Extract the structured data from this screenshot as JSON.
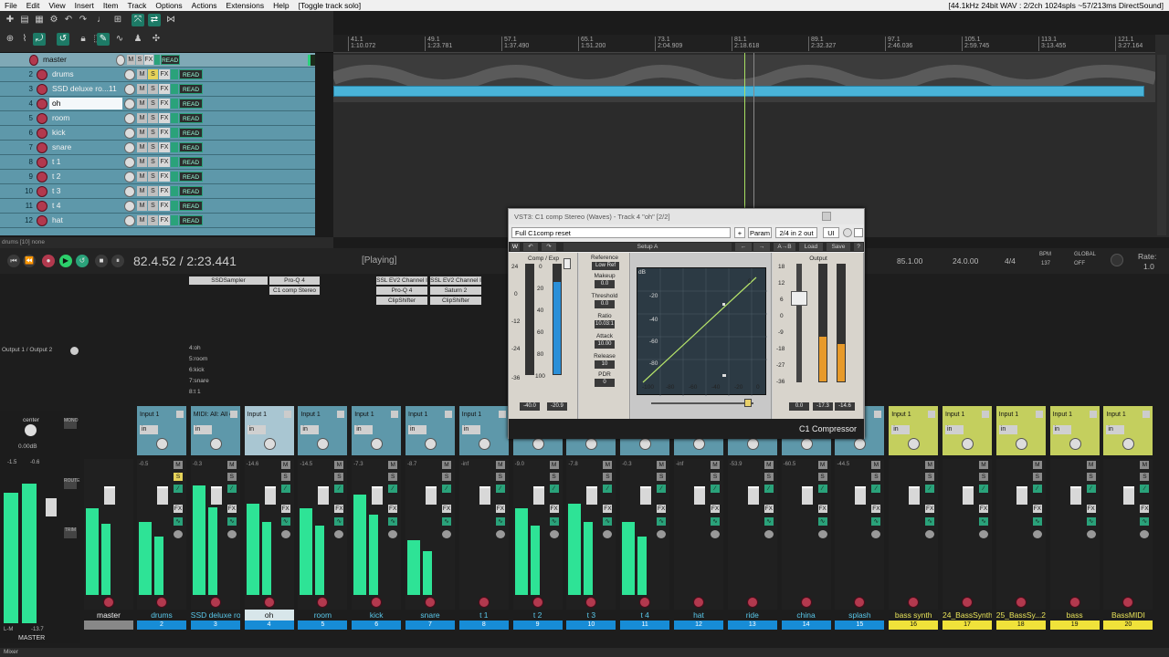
{
  "menu": {
    "items": [
      "File",
      "Edit",
      "View",
      "Insert",
      "Item",
      "Track",
      "Options",
      "Actions",
      "Extensions",
      "Help"
    ],
    "action_hint": "[Toggle track solo]",
    "audio_status": "[44.1kHz 24bit WAV : 2/2ch 1024spls ~57/213ms DirectSound]"
  },
  "tracks": [
    {
      "num": "",
      "name": "master"
    },
    {
      "num": "2",
      "name": "drums"
    },
    {
      "num": "3",
      "name": "SSD deluxe ro...11"
    },
    {
      "num": "4",
      "name": "oh"
    },
    {
      "num": "5",
      "name": "room"
    },
    {
      "num": "6",
      "name": "kick"
    },
    {
      "num": "7",
      "name": "snare"
    },
    {
      "num": "8",
      "name": "t 1"
    },
    {
      "num": "9",
      "name": "t 2"
    },
    {
      "num": "10",
      "name": "t 3"
    },
    {
      "num": "11",
      "name": "t 4"
    },
    {
      "num": "12",
      "name": "hat"
    }
  ],
  "tcp_buttons": {
    "m": "M",
    "s": "S",
    "fx": "FX",
    "read": "READ"
  },
  "ruler": [
    "41.1",
    "49.1",
    "57.1",
    "65.1",
    "73.1",
    "81.1",
    "89.1",
    "97.1",
    "105.1",
    "113.1",
    "121.1"
  ],
  "ruler_times": [
    "1:10.072",
    "1:23.781",
    "1:37.490",
    "1:51.200",
    "2:04.909",
    "2:18.618",
    "2:32.327",
    "2:46.036",
    "2:59.745",
    "3:13.455",
    "3:27.164"
  ],
  "status_line": "drums [10] none",
  "transport": {
    "position": "82.4.52 / 2:23.441",
    "state": "[Playing]",
    "sel_start": "85.1.00",
    "sel_end": "24.0.00",
    "timesig": "4/4",
    "bpm_label": "BPM",
    "bpm": "137",
    "global": "GLOBAL",
    "global_state": "OFF",
    "rate_label": "Rate:",
    "rate": "1.0"
  },
  "mixer": {
    "master_label": "MASTER",
    "master_name": "master",
    "master_db": "0.00dB",
    "master_pan": "center",
    "output_label": "Output 1 / Output 2",
    "master_peak_l": "-1.5",
    "master_peak_r": "-0.6",
    "master_lm": "L-M",
    "master_lm_val": "-13.7",
    "side_buttons": [
      "MONO",
      "ROUTE",
      "TRIM"
    ],
    "routing": [
      "4:oh",
      "5:room",
      "6:kick",
      "7:snare",
      "8:t 1"
    ],
    "fx": {
      "ssd": "SSDSampler",
      "proq": "Pro-Q 4",
      "c1": "C1 comp Stereo",
      "ssl1": "SSL EV2 Channel I",
      "ssl2": "SSL EV2 Channel I",
      "proq2": "Pro-Q 4",
      "sat": "Saturn 2",
      "clip1": "ClipShifter",
      "clip2": "ClipShifter"
    },
    "strips": [
      {
        "name": "drums",
        "num": "2",
        "input": "Input 1",
        "db": "-0.5"
      },
      {
        "name": "SSD deluxe rock ...11",
        "num": "3",
        "input": "MIDI: All: All channel",
        "db": "-0.3"
      },
      {
        "name": "oh",
        "num": "4",
        "input": "Input 1",
        "db": "-14.6"
      },
      {
        "name": "room",
        "num": "5",
        "input": "Input 1",
        "db": "-14.5"
      },
      {
        "name": "kick",
        "num": "6",
        "input": "Input 1",
        "db": "-7.3"
      },
      {
        "name": "snare",
        "num": "7",
        "input": "Input 1",
        "db": "-8.7"
      },
      {
        "name": "t 1",
        "num": "8",
        "input": "Input 1",
        "db": "-inf"
      },
      {
        "name": "t 2",
        "num": "9",
        "input": "Input 1",
        "db": "-9.0"
      },
      {
        "name": "t 3",
        "num": "10",
        "input": "Input 1",
        "db": "-7.8"
      },
      {
        "name": "t 4",
        "num": "11",
        "input": "Input 1",
        "db": "-0.3"
      },
      {
        "name": "hat",
        "num": "12",
        "input": "Input 1",
        "db": "-inf"
      },
      {
        "name": "ride",
        "num": "13",
        "input": "Input 1",
        "db": "-53.9"
      },
      {
        "name": "china",
        "num": "14",
        "input": "Input 1",
        "db": "-60.5"
      },
      {
        "name": "splash",
        "num": "15",
        "input": "Input 1",
        "db": "-44.5"
      },
      {
        "name": "bass synth",
        "num": "16",
        "input": "Input 1",
        "db": ""
      },
      {
        "name": "24_BassSynth",
        "num": "17",
        "input": "Input 1",
        "db": ""
      },
      {
        "name": "25_BassSy...2",
        "num": "18",
        "input": "Input 1",
        "db": ""
      },
      {
        "name": "bass",
        "num": "19",
        "input": "Input 1",
        "db": ""
      },
      {
        "name": "BassMIDI",
        "num": "20",
        "input": "Input 1",
        "db": ""
      }
    ],
    "in_label": "in"
  },
  "plugin": {
    "title": "VST3: C1 comp Stereo (Waves) - Track 4 \"oh\" [2/2]",
    "preset": "Full C1comp reset",
    "plus": "+",
    "param": "Param",
    "io": "2/4 in 2 out",
    "ui": "UI",
    "setup": "Setup A",
    "ab": "A→B",
    "load": "Load",
    "save": "Save",
    "help": "?",
    "comp_exp": "Comp / Exp",
    "reference": "Reference",
    "low_ref": "Low Ref",
    "makeup": "Makeup",
    "makeup_val": "0.0",
    "threshold": "Threshold",
    "threshold_val": "0.0",
    "ratio": "Ratio",
    "ratio_val": "10.03:1",
    "attack": "Attack",
    "attack_val": "10.00",
    "release": "Release",
    "release_val": "10",
    "pdr": "PDR",
    "pdr_val": "0",
    "graph_db": "dB",
    "graph_x": [
      "-100",
      "-80",
      "-60",
      "-40",
      "-20",
      "0"
    ],
    "graph_y": [
      "0",
      "-20",
      "-40",
      "-60",
      "-80"
    ],
    "in_scale": [
      "24",
      "0",
      "-12",
      "-24",
      "-36"
    ],
    "comp_scale": [
      "0",
      "20",
      "40",
      "60",
      "80",
      "100"
    ],
    "comp_vals": [
      "-40.0",
      "-20.9"
    ],
    "output_label": "Output",
    "out_scale": [
      "18",
      "12",
      "6",
      "0",
      "-9",
      "-18",
      "-27",
      "-36"
    ],
    "out_vals": [
      "0.0",
      "-17.3",
      "-14.6"
    ],
    "product": "C1 Compressor"
  },
  "bottom": "Mixer"
}
